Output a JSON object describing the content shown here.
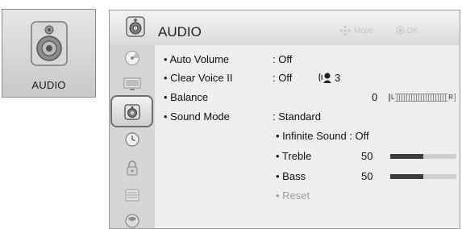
{
  "side_card": {
    "label": "AUDIO",
    "icon": "speaker-icon"
  },
  "header": {
    "title": "AUDIO",
    "move_hint": "Move",
    "ok_hint": "OK",
    "move_icon": "four-way-arrow-icon",
    "ok_icon": "ok-circle-icon"
  },
  "sidebar": [
    {
      "name": "disc-icon",
      "active": false
    },
    {
      "name": "monitor-icon",
      "active": false
    },
    {
      "name": "speaker-icon",
      "active": true
    },
    {
      "name": "clock-icon",
      "active": false
    },
    {
      "name": "lock-icon",
      "active": false
    },
    {
      "name": "option-icon",
      "active": false
    },
    {
      "name": "globe-icon",
      "active": false
    }
  ],
  "rows": {
    "auto_volume": {
      "label": "• Auto Volume",
      "value": ": Off"
    },
    "clear_voice": {
      "label": "• Clear Voice II",
      "value": ": Off",
      "level": "3"
    },
    "balance": {
      "label": "• Balance",
      "value": "0",
      "left": "L",
      "right": "R"
    },
    "sound_mode": {
      "label": "• Sound Mode",
      "value": ": Standard"
    },
    "infinite_sound": {
      "label": "• Infinite Sound : Off"
    },
    "treble": {
      "label": "• Treble",
      "value": "50",
      "level": 0.5
    },
    "bass": {
      "label": "• Bass",
      "value": "50",
      "level": 0.5
    },
    "reset": {
      "label": "• Reset"
    }
  },
  "colors": {
    "bar_fill": "#3c3c3c",
    "bar_track": "#cfcfcf",
    "hint": "#c6c6c6"
  }
}
